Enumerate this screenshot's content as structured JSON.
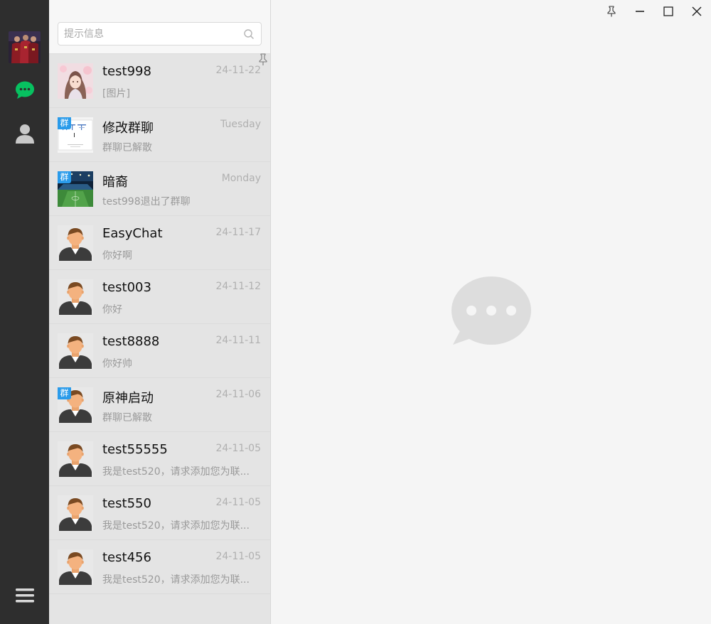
{
  "nav": {
    "avatar": "user-avatar",
    "items": [
      "chat-icon",
      "contacts-icon"
    ],
    "menu": "menu-icon",
    "active_color": "#07c160"
  },
  "search": {
    "placeholder": "提示信息",
    "value": ""
  },
  "group_badge_label": "群",
  "conversations": [
    {
      "name": "test998",
      "time": "24-11-22",
      "message": "[图片]",
      "group": false,
      "avatar": "anime-girl"
    },
    {
      "name": "修改群聊",
      "time": "Tuesday",
      "message": "群聊已解散",
      "group": true,
      "avatar": "document"
    },
    {
      "name": "暗裔",
      "time": "Monday",
      "message": "test998退出了群聊",
      "group": true,
      "avatar": "stadium"
    },
    {
      "name": "EasyChat",
      "time": "24-11-17",
      "message": "你好啊",
      "group": false,
      "avatar": "default-user"
    },
    {
      "name": "test003",
      "time": "24-11-12",
      "message": "你好",
      "group": false,
      "avatar": "default-user"
    },
    {
      "name": "test8888",
      "time": "24-11-11",
      "message": "你好帅",
      "group": false,
      "avatar": "default-user"
    },
    {
      "name": "原神启动",
      "time": "24-11-06",
      "message": "群聊已解散",
      "group": true,
      "avatar": "default-user"
    },
    {
      "name": "test55555",
      "time": "24-11-05",
      "message": "我是test520，请求添加您为联...",
      "group": false,
      "avatar": "default-user"
    },
    {
      "name": "test550",
      "time": "24-11-05",
      "message": "我是test520，请求添加您为联...",
      "group": false,
      "avatar": "default-user"
    },
    {
      "name": "test456",
      "time": "24-11-05",
      "message": "我是test520，请求添加您为联...",
      "group": false,
      "avatar": "default-user"
    }
  ],
  "window_controls": [
    "pin-icon",
    "minimize-icon",
    "maximize-icon",
    "close-icon"
  ],
  "empty_state_icon": "chat-bubble-icon"
}
